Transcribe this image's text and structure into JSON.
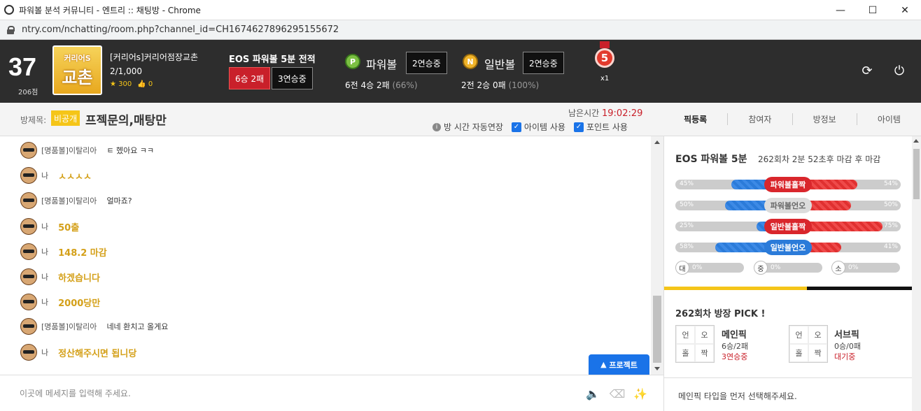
{
  "window": {
    "title": "파워볼 분석 커뮤니티 - 엔트리 :: 채팅방 - Chrome",
    "url": "ntry.com/nchatting/room.php?channel_id=CH1674627896295155672"
  },
  "user": {
    "level": "37",
    "points": "206점",
    "clan_logo_line1": "커리어S",
    "clan_logo_line2": "교촌",
    "name": "[커리어s]커리어점장교촌",
    "members": "2/1,000",
    "stars": "300",
    "likes": "0"
  },
  "eos": {
    "title": "EOS 파워볼 5분 전적",
    "record": "6승 2패",
    "streak": "3연승중"
  },
  "powerball": {
    "ball": "P",
    "label": "파워볼",
    "streak": "2연승중",
    "record_main": "6전 4승 2패",
    "record_pct": "(66%)"
  },
  "normalball": {
    "ball": "N",
    "label": "일반볼",
    "streak": "2연승중",
    "record_main": "2전 2승 0패",
    "record_pct": "(100%)"
  },
  "medal": {
    "number": "5",
    "count": "x1"
  },
  "room": {
    "label": "방제목:",
    "badge": "비공개",
    "title": "프젝문의,매탕만",
    "remain_label": "남은시간",
    "remain_time": "19:02:29",
    "auto_extend": "방 시간 자동연장",
    "item_use": "아이템 사용",
    "point_use": "포인트 사용"
  },
  "tabs": [
    "픽등록",
    "참여자",
    "방정보",
    "아이템"
  ],
  "messages": [
    {
      "who": "[명품볼]이탈리아",
      "text": "ㅌ 헸아요 ㅋㅋ",
      "style": "gray"
    },
    {
      "who": "나",
      "text": "ㅅㅅㅅㅅ",
      "style": "gold"
    },
    {
      "who": "[명품볼]이탈리아",
      "text": "얼마죠?",
      "style": "gray"
    },
    {
      "who": "나",
      "text": "50출",
      "style": "gold"
    },
    {
      "who": "나",
      "text": "148.2 마감",
      "style": "gold"
    },
    {
      "who": "나",
      "text": "하겠습니다",
      "style": "gold"
    },
    {
      "who": "나",
      "text": "2000당만",
      "style": "gold"
    },
    {
      "who": "[명품볼]이탈리아",
      "text": "네네 환치고 올게요",
      "style": "gray"
    },
    {
      "who": "나",
      "text": "정산해주시면 됩니당",
      "style": "gold"
    }
  ],
  "protect_button": "프로젝트",
  "input": {
    "placeholder": "이곳에 메세지를 입력해 주세요."
  },
  "sidebar": {
    "title": "EOS 파워볼 5분",
    "subtitle": "262회차 2분 52초후 마감 후 마감",
    "bars": [
      {
        "label": "파워볼홀짝",
        "left_pct": "45%",
        "right_pct": "54%",
        "left_value": 45,
        "label_color": "#d9262c"
      },
      {
        "label": "파워볼언오",
        "left_pct": "50%",
        "right_pct": "50%",
        "left_value": 50,
        "label_color": "#cccccc"
      },
      {
        "label": "일반볼홀짝",
        "left_pct": "25%",
        "right_pct": "75%",
        "left_value": 25,
        "label_color": "#d9262c"
      },
      {
        "label": "일반볼언오",
        "left_pct": "58%",
        "right_pct": "41%",
        "left_value": 58,
        "label_color": "#2b7bd9"
      }
    ],
    "sizes": [
      {
        "label": "대",
        "pct": "0%"
      },
      {
        "label": "중",
        "pct": "0%"
      },
      {
        "label": "소",
        "pct": "0%"
      }
    ],
    "pick_title": "262회차 방장 PICK !",
    "grid_cells": [
      "언",
      "오",
      "홀",
      "짝"
    ],
    "main_pick": {
      "name": "메인픽",
      "record": "6승/2패",
      "streak": "3연승중"
    },
    "sub_pick": {
      "name": "서브픽",
      "record": "0승/0패",
      "streak": "대기중"
    },
    "footer": "메인픽 타입을 먼저 선택해주세요."
  }
}
